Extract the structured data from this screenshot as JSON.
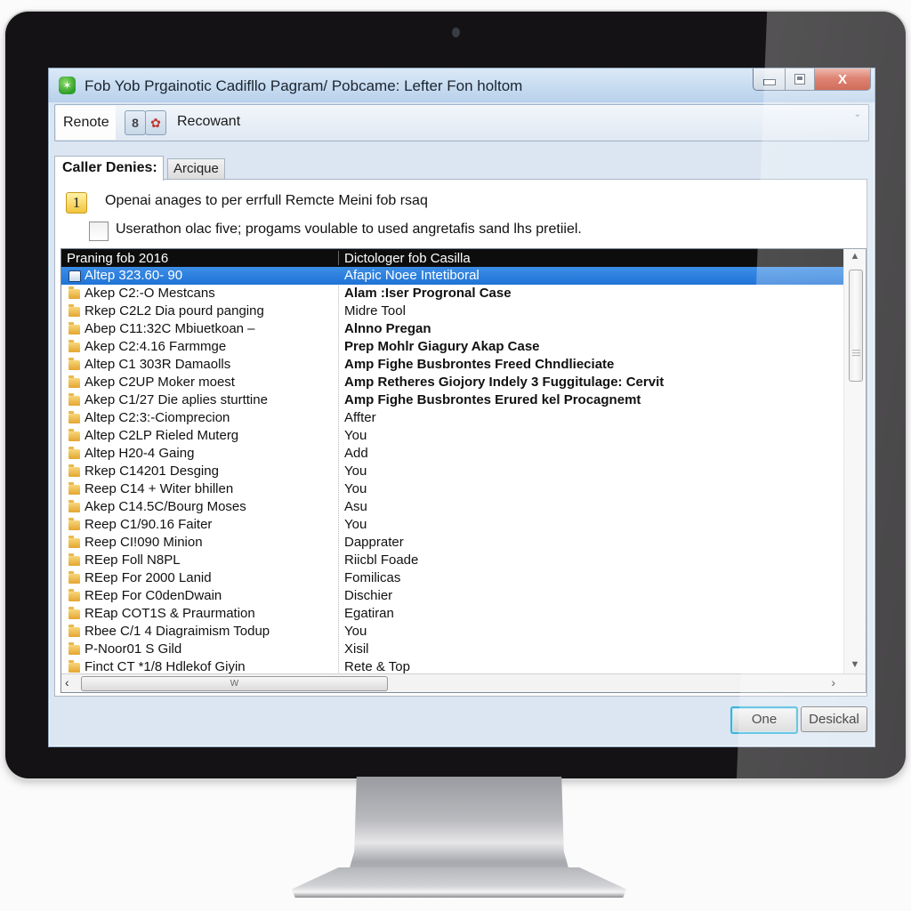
{
  "window": {
    "title": "Fob Yob Prgainotic Cadifllo Pagram/ Pobcame: Lefter Fon holtom",
    "app_icon": "app-logo-icon",
    "controls": {
      "minimize": "minimize-icon",
      "maximize": "maximize-icon",
      "close_glyph": "X"
    }
  },
  "toolbar": {
    "label": "Renote",
    "buttons": [
      {
        "icon": "shield-icon",
        "glyph": "8"
      },
      {
        "icon": "palette-icon",
        "glyph": "✿"
      }
    ],
    "text": "Recowant",
    "overflow_glyph": "⌄"
  },
  "tabs": [
    {
      "label": "Caller Denies:",
      "active": true
    },
    {
      "label": "Arcique",
      "active": false
    }
  ],
  "step": {
    "number": "1",
    "text": "Openai anages to per errfull Remcte Meini fob rsaq"
  },
  "option": {
    "checked": false,
    "text": "Userathon olac five; progams voulable to used angretafis sand lhs pretiiel."
  },
  "list": {
    "columns": [
      "Praning fob 2016",
      "Dictologer fob Casilla"
    ],
    "rows": [
      {
        "name": "Altep 323.60- 90",
        "desc": "Afapic Noee Intetiboral",
        "bold": false,
        "selected": true
      },
      {
        "name": "Akep C2:-O Mestcans",
        "desc": "Alam :Iser Progronal Case",
        "bold": true,
        "selected": false
      },
      {
        "name": "Rkep C2L2 Dia pourd panging",
        "desc": "Midre Tool",
        "bold": false,
        "selected": false
      },
      {
        "name": "Abep C11:32C Mbiuetkoan  –",
        "desc": "Alnno Pregan",
        "bold": true,
        "selected": false
      },
      {
        "name": "Akep C2:4.16 Farmmge",
        "desc": "Prep Mohlr Giagury Akap Case",
        "bold": true,
        "selected": false
      },
      {
        "name": "Altep C1 303R Damaolls",
        "desc": "Amp Fighe Busbrontes Freed Chndlieciate",
        "bold": true,
        "selected": false
      },
      {
        "name": "Akep C2UP Moker moest",
        "desc": "Amp Retheres Giojory Indely 3 Fuggitulage: Cervit",
        "bold": true,
        "selected": false
      },
      {
        "name": "Akep C1/27 Die aplies sturttine",
        "desc": "Amp Fighe Busbrontes Erured kel Procagnemt",
        "bold": true,
        "selected": false
      },
      {
        "name": "Altep C2:3:-Ciomprecion",
        "desc": "Affter",
        "bold": false,
        "selected": false
      },
      {
        "name": "Altep C2LP Rieled Muterg",
        "desc": "You",
        "bold": false,
        "selected": false
      },
      {
        "name": "Altep H20-4 Gaing",
        "desc": "Add",
        "bold": false,
        "selected": false
      },
      {
        "name": "Rkep C14201 Desging",
        "desc": "You",
        "bold": false,
        "selected": false
      },
      {
        "name": "Reep C14 + Witer bhillen",
        "desc": "You",
        "bold": false,
        "selected": false
      },
      {
        "name": "Akep C14.5C/Bourg Moses",
        "desc": "Asu",
        "bold": false,
        "selected": false
      },
      {
        "name": "Reep C1/90.16 Faiter",
        "desc": "You",
        "bold": false,
        "selected": false
      },
      {
        "name": "Reep CI!090 Minion",
        "desc": "Dapprater",
        "bold": false,
        "selected": false
      },
      {
        "name": "REep Foll N8PL",
        "desc": "Riicbl Foade",
        "bold": false,
        "selected": false
      },
      {
        "name": "REep For 2000 Lanid",
        "desc": "Fomilicas",
        "bold": false,
        "selected": false
      },
      {
        "name": "REep For C0denDwain",
        "desc": "Dischier",
        "bold": false,
        "selected": false
      },
      {
        "name": "REap COT1S & Praurmation",
        "desc": "Egatiran",
        "bold": false,
        "selected": false
      },
      {
        "name": "Rbee C/1 4 Diagraimism Todup",
        "desc": "You",
        "bold": false,
        "selected": false
      },
      {
        "name": "P-Noor01 S Gild",
        "desc": "Xisil",
        "bold": false,
        "selected": false
      },
      {
        "name": "Finct CT *1/8 Hdlekof Giyin",
        "desc": "Rete & Top",
        "bold": false,
        "selected": false
      }
    ],
    "hscroll_thumb_label": "W"
  },
  "buttons": {
    "ok": "One",
    "cancel": "Desickal"
  },
  "colors": {
    "selection": "#1f73d6",
    "header_bg": "#0d0d0d",
    "default_button_ring": "#3cb3d8",
    "close_button": "#c23a22"
  }
}
